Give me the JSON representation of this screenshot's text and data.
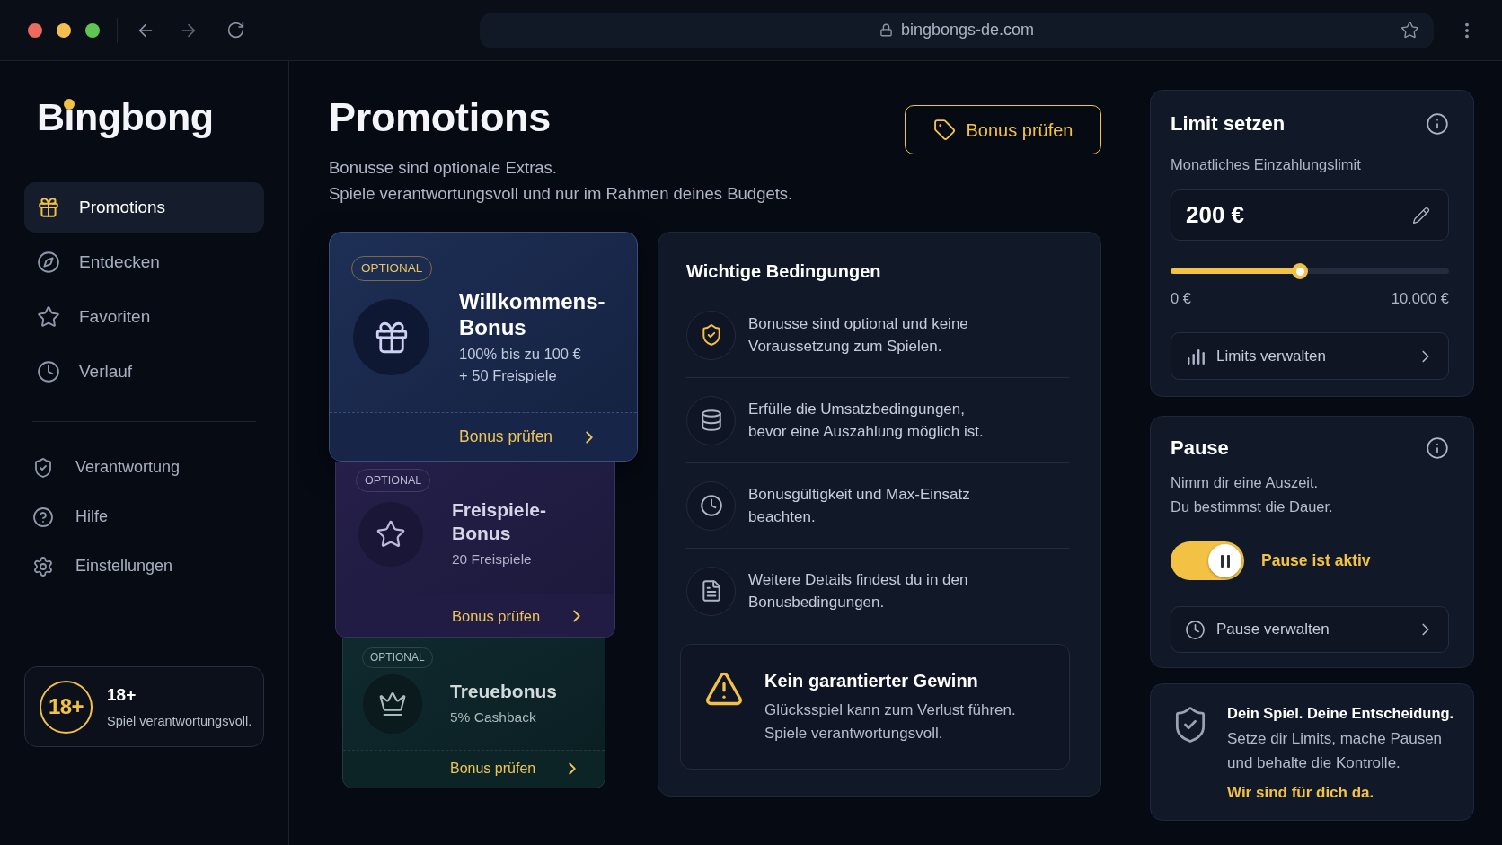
{
  "browser": {
    "url": "bingbongs-de.com"
  },
  "sidebar": {
    "logo": "Bingbong",
    "nav_items": [
      {
        "label": "Promotions",
        "selected": true
      },
      {
        "label": "Entdecken",
        "selected": false
      },
      {
        "label": "Favoriten",
        "selected": false
      },
      {
        "label": "Verlauf",
        "selected": false
      }
    ],
    "secondary_items": [
      {
        "label": "Verantwortung",
        "selected": false
      },
      {
        "label": "Hilfe",
        "selected": false
      },
      {
        "label": "Einstellungen",
        "selected": false
      }
    ],
    "age_notice": {
      "badge": "18+",
      "title": "18+",
      "text": "Spiel verantwortungsvoll."
    }
  },
  "header": {
    "title": "Promotions",
    "subtitle": "Bonusse sind optionale Extras.\nSpiele verantwortungsvoll und nur im Rahmen deines Budgets.",
    "button": "Bonus prüfen"
  },
  "bonus_cards": [
    {
      "kind": "welcome",
      "badge": "OPTIONAL",
      "title": "Willkommens-\nBonus",
      "detail": "100% bis zu 100 €\n+ 50 Freispiele",
      "button": "Bonus prüfen"
    },
    {
      "kind": "freespins",
      "badge": "OPTIONAL",
      "title": "Freispiele-\nBonus",
      "detail": "20 Freispiele",
      "button": "Bonus prüfen"
    },
    {
      "kind": "loyalty",
      "badge": "OPTIONAL",
      "title": "Treuebonus",
      "detail": "5% Cashback",
      "button": "Bonus prüfen"
    }
  ],
  "conditions": {
    "title": "Wichtige Bedingungen",
    "items": [
      {
        "text": "Bonusse sind optional und keine\nVoraussetzung zum Spielen."
      },
      {
        "text": "Erfülle die Umsatzbedingungen,\nbevor eine Auszahlung möglich ist."
      },
      {
        "text": "Bonusgültigkeit und Max-Einsatz\nbeachten."
      },
      {
        "text": "Weitere Details findest du in den\nBonusbedingungen."
      }
    ],
    "warning": {
      "title": "Kein garantierter Gewinn",
      "text": "Glücksspiel kann zum Verlust führen.\nSpiele verantwortungsvoll."
    }
  },
  "limit": {
    "title": "Limit setzen",
    "label": "Monatliches Einzahlungslimit",
    "value": "200 €",
    "level": 0.465,
    "min_label": "0 €",
    "max_label": "10.000 €",
    "button": "Limits verwalten"
  },
  "pause": {
    "title": "Pause",
    "text": "Nimm dir eine Auszeit.\nDu bestimmst die Dauer.",
    "on": true,
    "status": "Pause ist aktiv",
    "button": "Pause verwalten"
  },
  "info": {
    "title": "Dein Spiel. Deine Entscheidung.",
    "text": "Setze dir Limits, mache Pausen\nund behalte die Kontrolle.",
    "link": "Wir sind für dich da."
  }
}
